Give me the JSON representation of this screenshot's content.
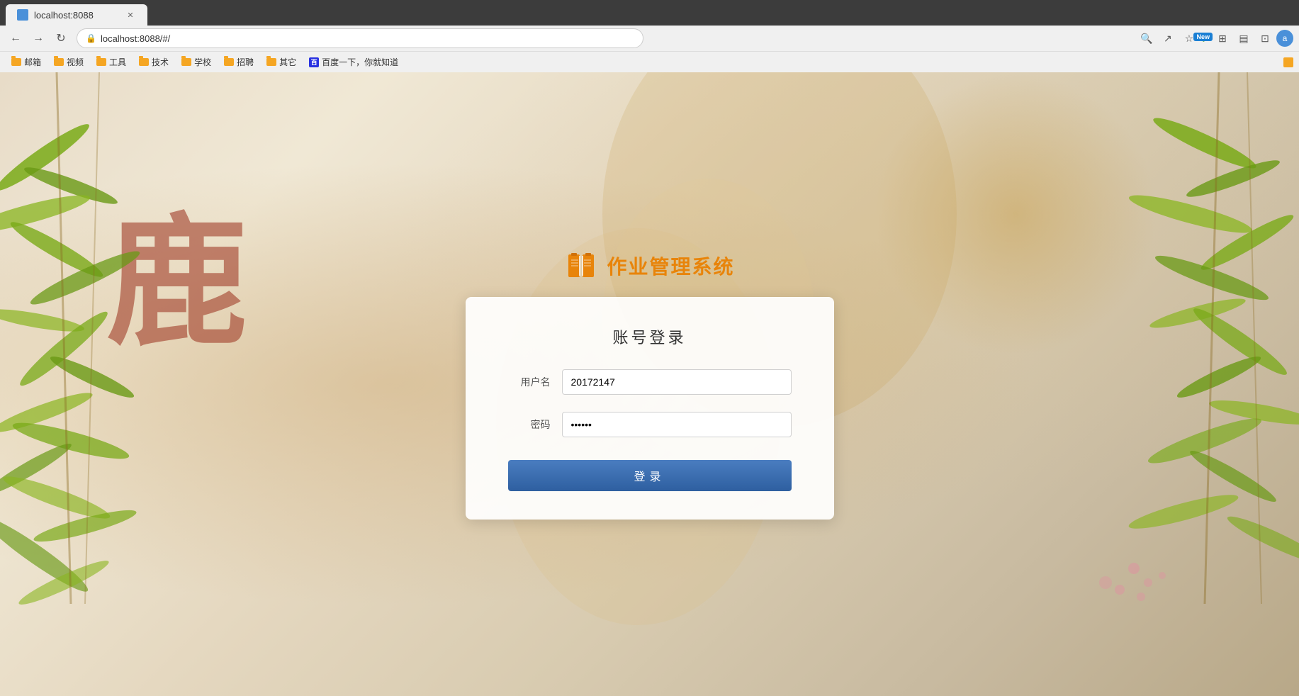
{
  "browser": {
    "url": "localhost:8088/#/",
    "tab_title": "localhost:8088",
    "nav": {
      "back_label": "←",
      "forward_label": "→",
      "refresh_label": "↻"
    },
    "bookmarks": [
      {
        "label": "邮箱",
        "type": "folder"
      },
      {
        "label": "视频",
        "type": "folder"
      },
      {
        "label": "工具",
        "type": "folder"
      },
      {
        "label": "技术",
        "type": "folder"
      },
      {
        "label": "学校",
        "type": "folder"
      },
      {
        "label": "招聘",
        "type": "folder"
      },
      {
        "label": "其它",
        "type": "folder"
      },
      {
        "label": "百度一下，你就知道",
        "type": "baidu"
      }
    ],
    "toolbar_icons": {
      "new_label": "New",
      "user_initial": "a"
    }
  },
  "app": {
    "title": "作业管理系统",
    "logo_alt": "book-icon"
  },
  "login": {
    "card_title": "账号登录",
    "username_label": "用户名",
    "username_value": "20172147",
    "password_label": "密码",
    "password_value": "······",
    "submit_label": "登录"
  }
}
